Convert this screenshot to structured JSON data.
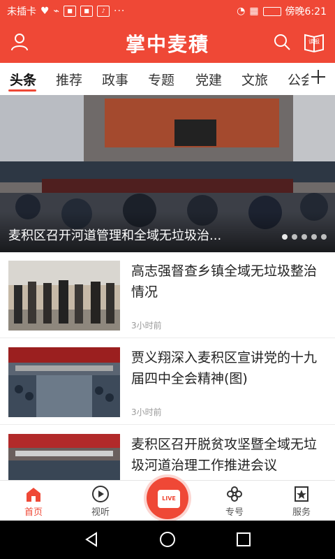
{
  "status": {
    "carrier": "未插卡",
    "time": "傍晚6:21",
    "more": "···",
    "colors": {
      "bar": "#ef4836"
    }
  },
  "header": {
    "title": "掌中麦積",
    "read_label": "读报",
    "icons": {
      "left": "user-icon",
      "search": "search-icon",
      "read": "newspaper-icon"
    }
  },
  "tabs": {
    "items": [
      "头条",
      "推荐",
      "政事",
      "专题",
      "党建",
      "文旅",
      "公会"
    ],
    "active": "头条"
  },
  "hero": {
    "caption": "麦积区召开河道管理和全域无垃圾治...",
    "dots": 5,
    "active_dot": 1
  },
  "news": [
    {
      "title": "高志强督查乡镇全域无垃圾整治情况",
      "time": "3小时前"
    },
    {
      "title": "贾义翔深入麦积区宣讲党的十九届四中全会精神(图)",
      "time": "3小时前"
    },
    {
      "title": "麦积区召开脱贫攻坚暨全域无垃圾河道治理工作推进会议",
      "time": ""
    }
  ],
  "nav": {
    "items": [
      {
        "label": "首页",
        "icon": "home-icon",
        "active": true
      },
      {
        "label": "视听",
        "icon": "play-icon",
        "active": false
      },
      {
        "label": "LIVE",
        "icon": "live-tv-icon",
        "active": false
      },
      {
        "label": "专号",
        "icon": "flower-icon",
        "active": false
      },
      {
        "label": "服务",
        "icon": "star-bookmark-icon",
        "active": false
      }
    ]
  },
  "colors": {
    "accent": "#ef4836",
    "text": "#222222",
    "muted": "#9a9a9a"
  }
}
